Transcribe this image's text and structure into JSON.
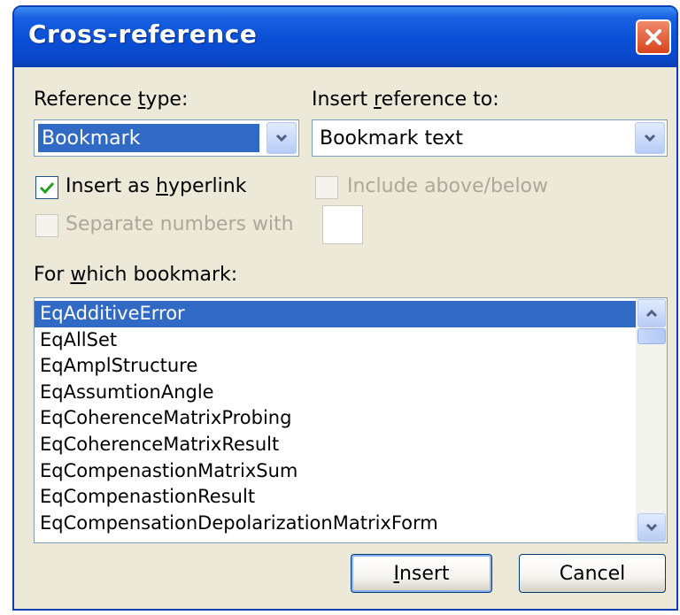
{
  "window": {
    "title": "Cross-reference"
  },
  "reference_type": {
    "label_pre": "Reference ",
    "label_u": "t",
    "label_post": "ype:",
    "value": "Bookmark"
  },
  "insert_reference_to": {
    "label_pre": "Insert ",
    "label_u": "r",
    "label_post": "eference to:",
    "value": "Bookmark text"
  },
  "options": {
    "insert_hyperlink": {
      "pre": "Insert as ",
      "u": "h",
      "post": "yperlink",
      "checked": true
    },
    "include_above_below": {
      "label": "Include above/below",
      "enabled": false
    },
    "separate_numbers": {
      "label": "Separate numbers with",
      "enabled": false
    }
  },
  "bookmark_list": {
    "label_pre": "For ",
    "label_u": "w",
    "label_post": "hich bookmark:",
    "selected_index": 0,
    "items": [
      "EqAdditiveError",
      "EqAllSet",
      "EqAmplStructure",
      "EqAssumtionAngle",
      "EqCoherenceMatrixProbing",
      "EqCoherenceMatrixResult",
      "EqCompenastionMatrixSum",
      "EqCompenastionResult",
      "EqCompensationDepolarizationMatrixForm"
    ]
  },
  "buttons": {
    "insert": {
      "u": "I",
      "post": "nsert"
    },
    "cancel": "Cancel"
  },
  "colors": {
    "title_bar": "#0a4fd6",
    "selection": "#316ac5",
    "close": "#d8431e",
    "dialog_bg": "#ece9d8"
  }
}
